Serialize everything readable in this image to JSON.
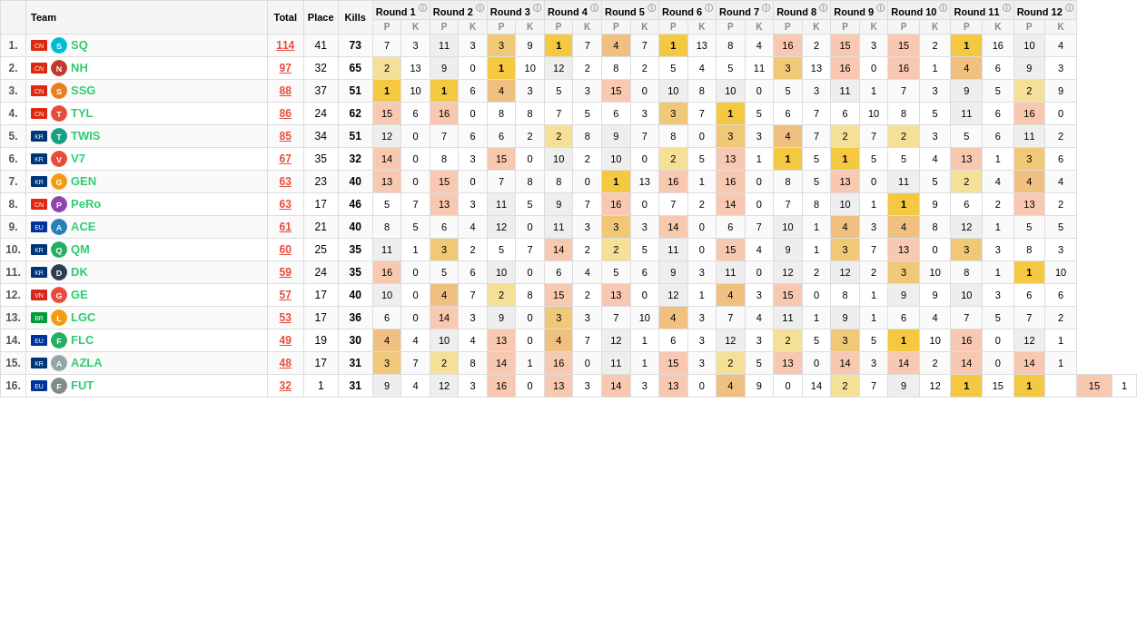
{
  "table": {
    "columns": {
      "rank": "#",
      "team": "Team",
      "total": "Total",
      "place": "Place",
      "kills": "Kills"
    },
    "rounds": [
      "Round 1",
      "Round 2",
      "Round 3",
      "Round 4",
      "Round 5",
      "Round 6",
      "Round 7",
      "Round 8",
      "Round 9",
      "Round 10",
      "Round 11",
      "Round 12"
    ],
    "subheaders": [
      "P",
      "K"
    ],
    "rows": [
      {
        "rank": "1.",
        "flag": "CN",
        "logo": "SQ",
        "name": "SQ",
        "total": "114",
        "place": "41",
        "kills": "73",
        "rounds": [
          [
            7,
            3
          ],
          [
            11,
            3
          ],
          [
            3,
            9
          ],
          [
            1,
            7
          ],
          [
            4,
            7
          ],
          [
            1,
            13
          ],
          [
            8,
            4
          ],
          [
            16,
            2
          ],
          [
            15,
            3
          ],
          [
            15,
            2
          ],
          [
            1,
            16
          ],
          [
            10,
            4
          ]
        ]
      },
      {
        "rank": "2.",
        "flag": "CN",
        "logo": "NH",
        "name": "NH",
        "total": "97",
        "place": "32",
        "kills": "65",
        "rounds": [
          [
            2,
            13
          ],
          [
            9,
            0
          ],
          [
            1,
            10
          ],
          [
            12,
            2
          ],
          [
            8,
            2
          ],
          [
            5,
            4
          ],
          [
            5,
            11
          ],
          [
            3,
            13
          ],
          [
            16,
            0
          ],
          [
            16,
            1
          ],
          [
            4,
            6
          ],
          [
            9,
            3
          ]
        ]
      },
      {
        "rank": "3.",
        "flag": "CN",
        "logo": "SSG",
        "name": "SSG",
        "total": "88",
        "place": "37",
        "kills": "51",
        "rounds": [
          [
            1,
            10
          ],
          [
            1,
            6
          ],
          [
            4,
            3
          ],
          [
            5,
            3
          ],
          [
            15,
            0
          ],
          [
            10,
            8
          ],
          [
            10,
            0
          ],
          [
            5,
            3
          ],
          [
            11,
            1
          ],
          [
            7,
            3
          ],
          [
            9,
            5
          ],
          [
            2,
            9
          ]
        ]
      },
      {
        "rank": "4.",
        "flag": "CN",
        "logo": "TYL",
        "name": "TYL",
        "total": "86",
        "place": "24",
        "kills": "62",
        "rounds": [
          [
            15,
            6
          ],
          [
            16,
            0
          ],
          [
            8,
            8
          ],
          [
            7,
            5
          ],
          [
            6,
            3
          ],
          [
            3,
            7
          ],
          [
            1,
            5
          ],
          [
            6,
            7
          ],
          [
            6,
            10
          ],
          [
            8,
            5
          ],
          [
            11,
            6
          ],
          [
            16,
            0
          ]
        ]
      },
      {
        "rank": "5.",
        "flag": "KR",
        "logo": "TWIS",
        "name": "TWIS",
        "total": "85",
        "place": "34",
        "kills": "51",
        "rounds": [
          [
            12,
            0
          ],
          [
            7,
            6
          ],
          [
            6,
            2
          ],
          [
            2,
            8
          ],
          [
            9,
            7
          ],
          [
            8,
            0
          ],
          [
            3,
            3
          ],
          [
            4,
            7
          ],
          [
            2,
            7
          ],
          [
            2,
            3
          ],
          [
            5,
            6
          ],
          [
            11,
            2
          ]
        ]
      },
      {
        "rank": "6.",
        "flag": "KR",
        "logo": "V7",
        "name": "V7",
        "total": "67",
        "place": "35",
        "kills": "32",
        "rounds": [
          [
            14,
            0
          ],
          [
            8,
            3
          ],
          [
            15,
            0
          ],
          [
            10,
            2
          ],
          [
            10,
            0
          ],
          [
            2,
            5
          ],
          [
            13,
            1
          ],
          [
            1,
            5
          ],
          [
            1,
            5
          ],
          [
            5,
            4
          ],
          [
            13,
            1
          ],
          [
            3,
            6
          ]
        ]
      },
      {
        "rank": "7.",
        "flag": "KR",
        "logo": "GEN",
        "name": "GEN",
        "total": "63",
        "place": "23",
        "kills": "40",
        "rounds": [
          [
            13,
            0
          ],
          [
            15,
            0
          ],
          [
            7,
            8
          ],
          [
            8,
            0
          ],
          [
            1,
            13
          ],
          [
            16,
            1
          ],
          [
            16,
            0
          ],
          [
            8,
            5
          ],
          [
            13,
            0
          ],
          [
            11,
            5
          ],
          [
            2,
            4
          ],
          [
            4,
            4
          ]
        ]
      },
      {
        "rank": "8.",
        "flag": "CN",
        "logo": "PeRo",
        "name": "PeRo",
        "total": "63",
        "place": "17",
        "kills": "46",
        "rounds": [
          [
            5,
            7
          ],
          [
            13,
            3
          ],
          [
            11,
            5
          ],
          [
            9,
            7
          ],
          [
            16,
            0
          ],
          [
            7,
            2
          ],
          [
            14,
            0
          ],
          [
            7,
            8
          ],
          [
            10,
            1
          ],
          [
            1,
            9
          ],
          [
            6,
            2
          ],
          [
            13,
            2
          ]
        ]
      },
      {
        "rank": "9.",
        "flag": "EU",
        "logo": "ACE",
        "name": "ACE",
        "total": "61",
        "place": "21",
        "kills": "40",
        "rounds": [
          [
            8,
            5
          ],
          [
            6,
            4
          ],
          [
            12,
            0
          ],
          [
            11,
            3
          ],
          [
            3,
            3
          ],
          [
            14,
            0
          ],
          [
            6,
            7
          ],
          [
            10,
            1
          ],
          [
            4,
            3
          ],
          [
            4,
            8
          ],
          [
            12,
            1
          ],
          [
            5,
            5
          ]
        ]
      },
      {
        "rank": "10.",
        "flag": "KR",
        "logo": "QM",
        "name": "QM",
        "total": "60",
        "place": "25",
        "kills": "35",
        "rounds": [
          [
            11,
            1
          ],
          [
            3,
            2
          ],
          [
            5,
            7
          ],
          [
            14,
            2
          ],
          [
            2,
            5
          ],
          [
            11,
            0
          ],
          [
            15,
            4
          ],
          [
            9,
            1
          ],
          [
            3,
            7
          ],
          [
            13,
            0
          ],
          [
            3,
            3
          ],
          [
            8,
            3
          ]
        ]
      },
      {
        "rank": "11.",
        "flag": "KR",
        "logo": "DK",
        "name": "DK",
        "total": "59",
        "place": "24",
        "kills": "35",
        "rounds": [
          [
            16,
            0
          ],
          [
            5,
            6
          ],
          [
            10,
            0
          ],
          [
            6,
            4
          ],
          [
            5,
            6
          ],
          [
            9,
            3
          ],
          [
            11,
            0
          ],
          [
            12,
            2
          ],
          [
            12,
            2
          ],
          [
            3,
            10
          ],
          [
            8,
            1
          ],
          [
            1,
            10
          ]
        ]
      },
      {
        "rank": "12.",
        "flag": "VN",
        "logo": "GE",
        "name": "GE",
        "total": "57",
        "place": "17",
        "kills": "40",
        "rounds": [
          [
            10,
            0
          ],
          [
            4,
            7
          ],
          [
            2,
            8
          ],
          [
            15,
            2
          ],
          [
            13,
            0
          ],
          [
            12,
            1
          ],
          [
            4,
            3
          ],
          [
            15,
            0
          ],
          [
            8,
            1
          ],
          [
            9,
            9
          ],
          [
            10,
            3
          ],
          [
            6,
            6
          ]
        ]
      },
      {
        "rank": "13.",
        "flag": "BR",
        "logo": "LGC",
        "name": "LGC",
        "total": "53",
        "place": "17",
        "kills": "36",
        "rounds": [
          [
            6,
            0
          ],
          [
            14,
            3
          ],
          [
            9,
            0
          ],
          [
            3,
            3
          ],
          [
            7,
            10
          ],
          [
            4,
            3
          ],
          [
            7,
            4
          ],
          [
            11,
            1
          ],
          [
            9,
            1
          ],
          [
            6,
            4
          ],
          [
            7,
            5
          ],
          [
            7,
            2
          ]
        ]
      },
      {
        "rank": "14.",
        "flag": "EU",
        "logo": "FLC",
        "name": "FLC",
        "total": "49",
        "place": "19",
        "kills": "30",
        "rounds": [
          [
            4,
            4
          ],
          [
            10,
            4
          ],
          [
            13,
            0
          ],
          [
            4,
            7
          ],
          [
            12,
            1
          ],
          [
            6,
            3
          ],
          [
            12,
            3
          ],
          [
            2,
            5
          ],
          [
            3,
            5
          ],
          [
            1,
            10
          ],
          [
            16,
            0
          ],
          [
            12,
            1
          ]
        ]
      },
      {
        "rank": "15.",
        "flag": "KR",
        "logo": "AZLA",
        "name": "AZLA",
        "total": "48",
        "place": "17",
        "kills": "31",
        "rounds": [
          [
            3,
            7
          ],
          [
            2,
            8
          ],
          [
            14,
            1
          ],
          [
            16,
            0
          ],
          [
            11,
            1
          ],
          [
            15,
            3
          ],
          [
            2,
            5
          ],
          [
            13,
            0
          ],
          [
            14,
            3
          ],
          [
            14,
            2
          ],
          [
            14,
            0
          ],
          [
            14,
            1
          ]
        ]
      },
      {
        "rank": "16.",
        "flag": "EU",
        "logo": "FUT",
        "name": "FUT",
        "total": "32",
        "place": "1",
        "kills": "31",
        "rounds": [
          [
            9,
            4
          ],
          [
            12,
            3
          ],
          [
            16,
            0
          ],
          [
            13,
            3
          ],
          [
            14,
            3
          ],
          [
            13,
            0
          ],
          [
            4,
            9
          ],
          [
            0,
            14
          ],
          [
            2,
            7
          ],
          [
            9,
            12
          ],
          [
            1,
            15
          ],
          [
            1
          ],
          [
            15,
            1
          ]
        ]
      }
    ]
  }
}
